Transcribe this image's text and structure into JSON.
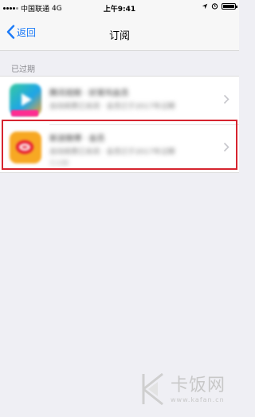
{
  "status_bar": {
    "carrier": "中国联通",
    "network": "4G",
    "time": "上午9:41"
  },
  "nav": {
    "back_label": "返回",
    "title": "订阅"
  },
  "section": {
    "header": "已过期"
  },
  "subscriptions": [
    {
      "app_icon": "video-app-icon",
      "title": "腾讯视频 · 好莱坞会员",
      "detail": "自动续费已关闭 · 会员已于2017年过期",
      "note": "已过期"
    },
    {
      "app_icon": "weibo-icon",
      "title": "新浪微博 · 会员",
      "detail": "自动续费已关闭 · 会员已于2017年过期",
      "note": "已过期"
    }
  ],
  "watermark": {
    "text": "卡饭网",
    "url": "www.kafan.cn"
  },
  "colors": {
    "ios_blue": "#1a7af8",
    "highlight_red": "#d6242f",
    "background": "#efeff4"
  }
}
